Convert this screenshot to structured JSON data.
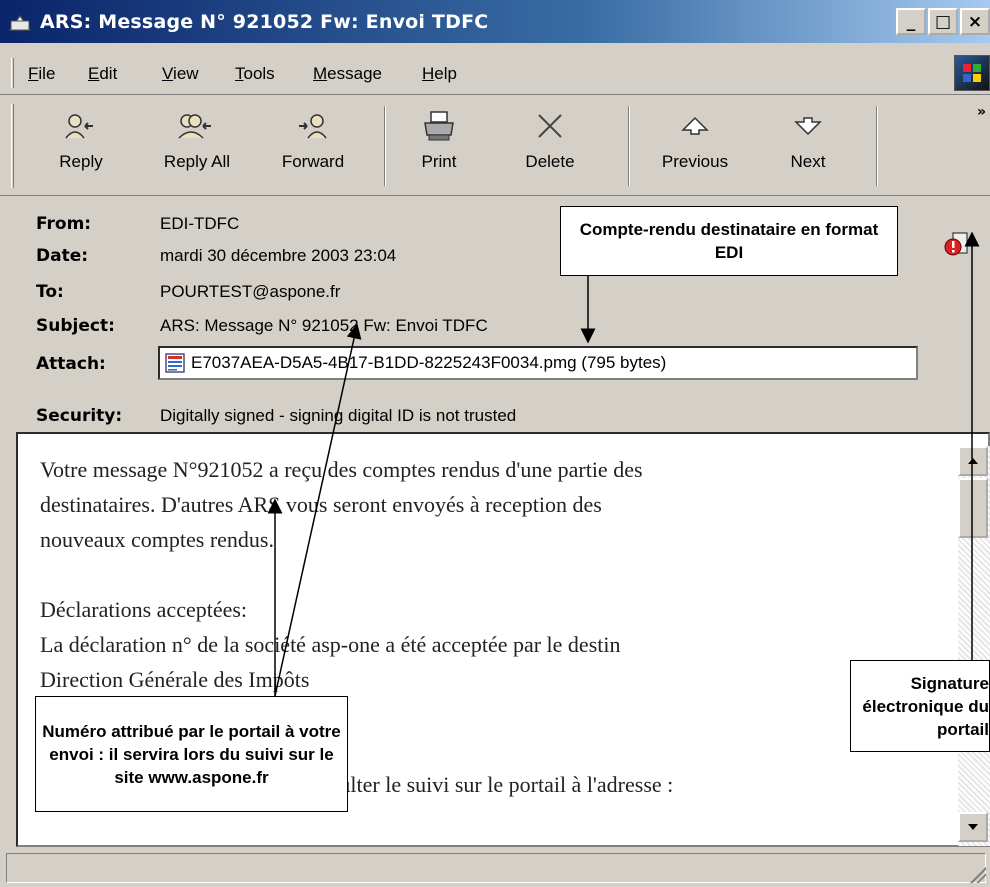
{
  "window": {
    "title": "ARS: Message N° 921052 Fw: Envoi TDFC",
    "controls": {
      "minimize": "_",
      "maximize": "□",
      "close": "×"
    }
  },
  "menu": {
    "items": [
      {
        "label": "File",
        "accel": "F",
        "rest": "ile"
      },
      {
        "label": "Edit",
        "accel": "E",
        "rest": "dit"
      },
      {
        "label": "View",
        "accel": "V",
        "rest": "iew"
      },
      {
        "label": "Tools",
        "accel": "T",
        "rest": "ools"
      },
      {
        "label": "Message",
        "accel": "M",
        "rest": "essage"
      },
      {
        "label": "Help",
        "accel": "H",
        "rest": "elp"
      }
    ]
  },
  "toolbar": {
    "reply": "Reply",
    "reply_all": "Reply All",
    "forward": "Forward",
    "print": "Print",
    "delete": "Delete",
    "previous": "Previous",
    "next": "Next",
    "more": "»"
  },
  "header": {
    "from_label": "From:",
    "from": "EDI-TDFC",
    "date_label": "Date:",
    "date": "mardi 30 décembre 2003 23:04",
    "to_label": "To:",
    "to": "POURTEST@aspone.fr",
    "subject_label": "Subject:",
    "subject": "ARS: Message N° 921052 Fw: Envoi TDFC",
    "attach_label": "Attach:",
    "attachment": "E7037AEA-D5A5-4B17-B1DD-8225243F0034.pmg (795 bytes)",
    "security_label": "Security:",
    "security": "Digitally signed - signing digital ID is not trusted"
  },
  "body": {
    "line1": "Votre message N°921052 a reçu des comptes rendus d'une partie des",
    "line2": "destinataires. D'autres ARS vous seront envoyés à reception des",
    "line3": "nouveaux comptes rendus.",
    "line4": "Déclarations acceptées:",
    "line5": "La déclaration n°  de la société asp-one a été acceptée par le destin",
    "line6": "Direction Générale des Impôts",
    "line7": "Pour plus de détails, veuillez consulter le suivi sur le portail à l'adresse :"
  },
  "callouts": {
    "edi": "Compte-rendu destinataire en format EDI",
    "numero": "Numéro attribué par le portail à votre envoi : il servira lors du suivi sur le site www.aspone.fr",
    "signature": "Signature électronique du portail"
  }
}
